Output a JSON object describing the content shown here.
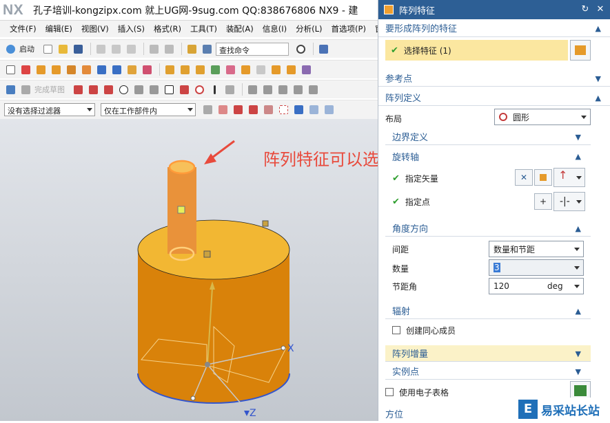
{
  "app": {
    "logo": "NX",
    "window_title": "孔子培训-kongzipx.com 就上UG网-9sug.com QQ:838676806 NX9 - 建"
  },
  "menu": [
    "文件(F)",
    "编辑(E)",
    "视图(V)",
    "插入(S)",
    "格式(R)",
    "工具(T)",
    "装配(A)",
    "信息(I)",
    "分析(L)",
    "首选项(P)",
    "窗"
  ],
  "toolbar": {
    "start_label": "启动",
    "search_placeholder": "查找命令",
    "finish_sketch": "完成草图",
    "filter_value": "没有选择过滤器",
    "scope_value": "仅在工作部件内"
  },
  "annotation": {
    "text": "阵列特征可以选择小圆柱",
    "color": "#e84a3c"
  },
  "viewport_labels": {
    "x_axis": "X",
    "z_axis": "Z"
  },
  "dialog": {
    "title": "阵列特征",
    "sections": {
      "feature_to_pattern": "要形成阵列的特征",
      "select_feature": "选择特征 (1)",
      "reference_point": "参考点",
      "pattern_definition": "阵列定义",
      "layout_label": "布局",
      "layout_value": "圆形",
      "boundary": "边界定义",
      "rotation_axis": "旋转轴",
      "specify_vector": "指定矢量",
      "specify_point": "指定点",
      "angle_direction": "角度方向",
      "spacing_label": "间距",
      "spacing_value": "数量和节距",
      "count_label": "数量",
      "count_value": "3",
      "pitch_label": "节距角",
      "pitch_value": "120",
      "pitch_unit": "deg",
      "radiation": "辐射",
      "create_concentric": "创建同心成员",
      "pattern_increment": "阵列增量",
      "instance_point": "实例点",
      "use_spreadsheet": "使用电子表格",
      "orientation": "方位"
    }
  },
  "watermark": {
    "logo": "E",
    "text": "易采站长站"
  },
  "colors": {
    "title_blue": "#2d5f95",
    "section_text": "#2b5d94",
    "highlight": "#fbf2c8",
    "cylinder_face": "#f2b733",
    "cylinder_side": "#d9820a",
    "annotation": "#e84a3c"
  }
}
